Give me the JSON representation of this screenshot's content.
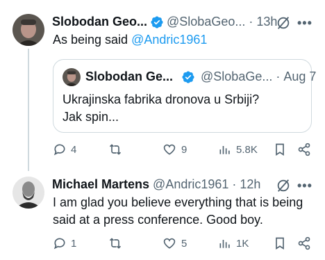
{
  "tweet1": {
    "author_name": "Slobodan Geo...",
    "handle": "@SlobaGeo...",
    "separator": "·",
    "time": "13h",
    "text_prefix": "As being said ",
    "mention": "@Andric1961",
    "quote": {
      "author_name": "Slobodan Ge...",
      "handle": "@SlobaGe...",
      "separator": "·",
      "time": "Aug 7",
      "line1": "Ukrajinska fabrika dronova u Srbiji?",
      "line2": "Jak spin..."
    },
    "actions": {
      "replies": "4",
      "reposts": "",
      "likes": "9",
      "views": "5.8K"
    }
  },
  "tweet2": {
    "author_name": "Michael Martens",
    "handle": "@Andric1961",
    "separator": "·",
    "time": "12h",
    "line1": "I am glad you believe everything that is being",
    "line2": "said at a press conference. Good boy.",
    "actions": {
      "replies": "1",
      "reposts": "",
      "likes": "5",
      "views": "1K"
    }
  },
  "more_label": "•••",
  "colors": {
    "link": "#1d9bf0",
    "secondary_text": "#536471",
    "border": "#cfd9de",
    "verified": "#1d9bf0"
  }
}
